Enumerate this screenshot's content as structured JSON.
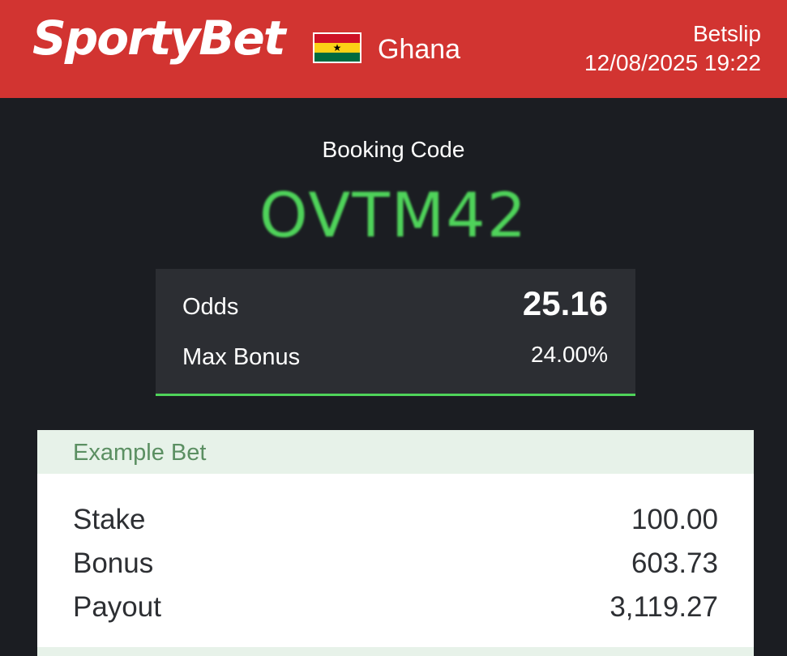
{
  "header": {
    "brand": "SportyBet",
    "country": "Ghana",
    "flag_icon": "ghana-flag-icon",
    "title": "Betslip",
    "datetime": "12/08/2025 19:22"
  },
  "booking": {
    "label": "Booking Code",
    "code": "OVTM42"
  },
  "summary": {
    "odds_label": "Odds",
    "odds_value": "25.16",
    "max_bonus_label": "Max Bonus",
    "max_bonus_value": "24.00%"
  },
  "example_bet": {
    "title": "Example Bet",
    "rows": [
      {
        "label": "Stake",
        "value": "100.00"
      },
      {
        "label": "Bonus",
        "value": "603.73"
      },
      {
        "label": "Payout",
        "value": "3,119.27"
      }
    ]
  },
  "colors": {
    "brand_red": "#d23431",
    "accent_green": "#4fd35a",
    "background": "#1b1d22",
    "panel": "#2c2e33",
    "card_header": "#e7f2e9"
  }
}
